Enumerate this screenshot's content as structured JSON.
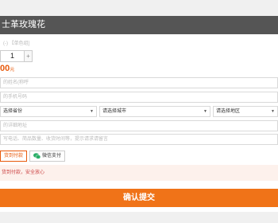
{
  "header": {
    "title": "士革玫瑰花"
  },
  "form": {
    "hint": "(-) 【单色组]",
    "quantity": "1",
    "plus": "+",
    "price": "00",
    "price_unit": "元",
    "name_placeholder": "的姓名(称呼",
    "phone_placeholder": "的手机号码",
    "province": "选择省份",
    "city": "请选择城市",
    "district": "请选择地区",
    "address_placeholder": "的详细地址",
    "remark_placeholder": "写电话、简品数量、收货时间等，提示请求请留言"
  },
  "payment": {
    "cod_label": "货到付款",
    "wechat_label": "微信支付"
  },
  "notice": {
    "text": "货到付款，安全放心"
  },
  "submit": {
    "label": "确认提交"
  }
}
